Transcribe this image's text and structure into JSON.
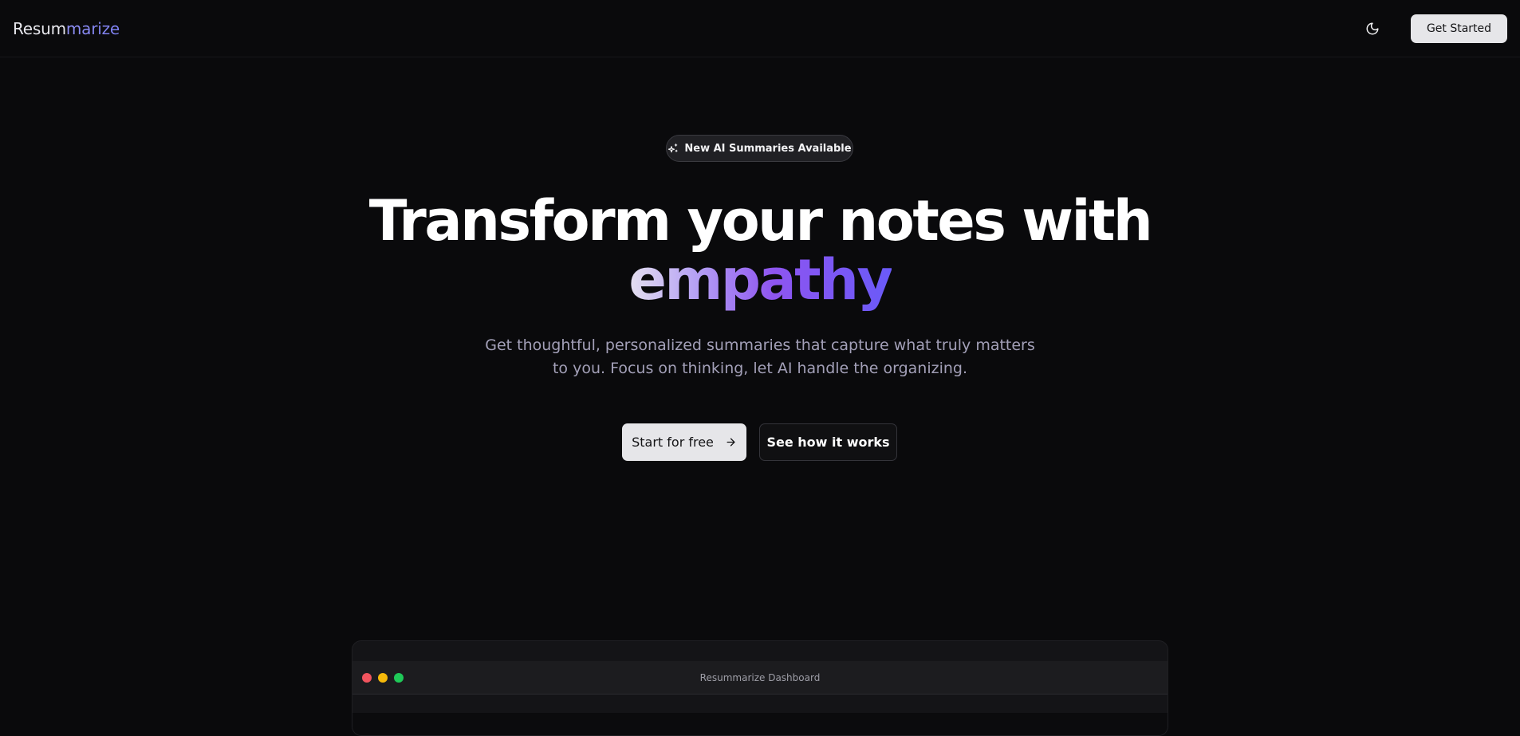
{
  "header": {
    "logo_part_1": "Resum",
    "logo_part_2": "marize",
    "theme_toggle_icon": "moon-icon",
    "get_started_label": "Get Started"
  },
  "hero": {
    "badge_icon": "sparkles-icon",
    "badge_label": "New AI Summaries Available",
    "headline_line_1": "Transform your notes with",
    "headline_accent": "empathy",
    "subtitle": "Get thoughtful, personalized summaries that capture what truly matters to you. Focus on thinking, let AI handle the organizing.",
    "primary_cta_label": "Start for free",
    "primary_cta_icon": "arrow-right-icon",
    "secondary_cta_label": "See how it works"
  },
  "preview": {
    "window_title": "Resummarize Dashboard",
    "window_dots": [
      "#f1545e",
      "#f5b90a",
      "#1fc958"
    ]
  },
  "colors": {
    "background": "#0a0a0c",
    "accent_gradient_start": "#e5e0f0",
    "accent_gradient_mid": "#8e55f0",
    "accent_gradient_end": "#6a5af8",
    "button_light": "#e6e6e9"
  }
}
